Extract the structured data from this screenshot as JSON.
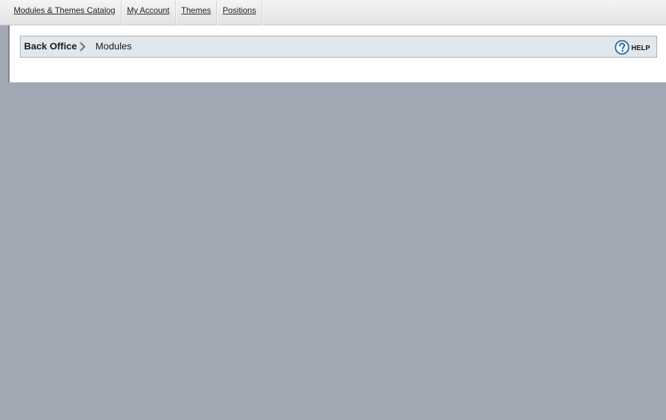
{
  "top_nav": {
    "items": [
      {
        "label": "Modules & Themes Catalog"
      },
      {
        "label": "My Account"
      },
      {
        "label": "Themes"
      },
      {
        "label": "Positions"
      }
    ]
  },
  "breadcrumb": {
    "root": "Back Office",
    "separator_icon": "chevron-right-icon",
    "current": "Modules"
  },
  "help": {
    "icon": "question-circle-icon",
    "label": "HELP"
  },
  "colors": {
    "background": "#a2a9b4",
    "breadcrumb_bar": "#e0e8ee",
    "help_icon": "#2d6aa3"
  }
}
